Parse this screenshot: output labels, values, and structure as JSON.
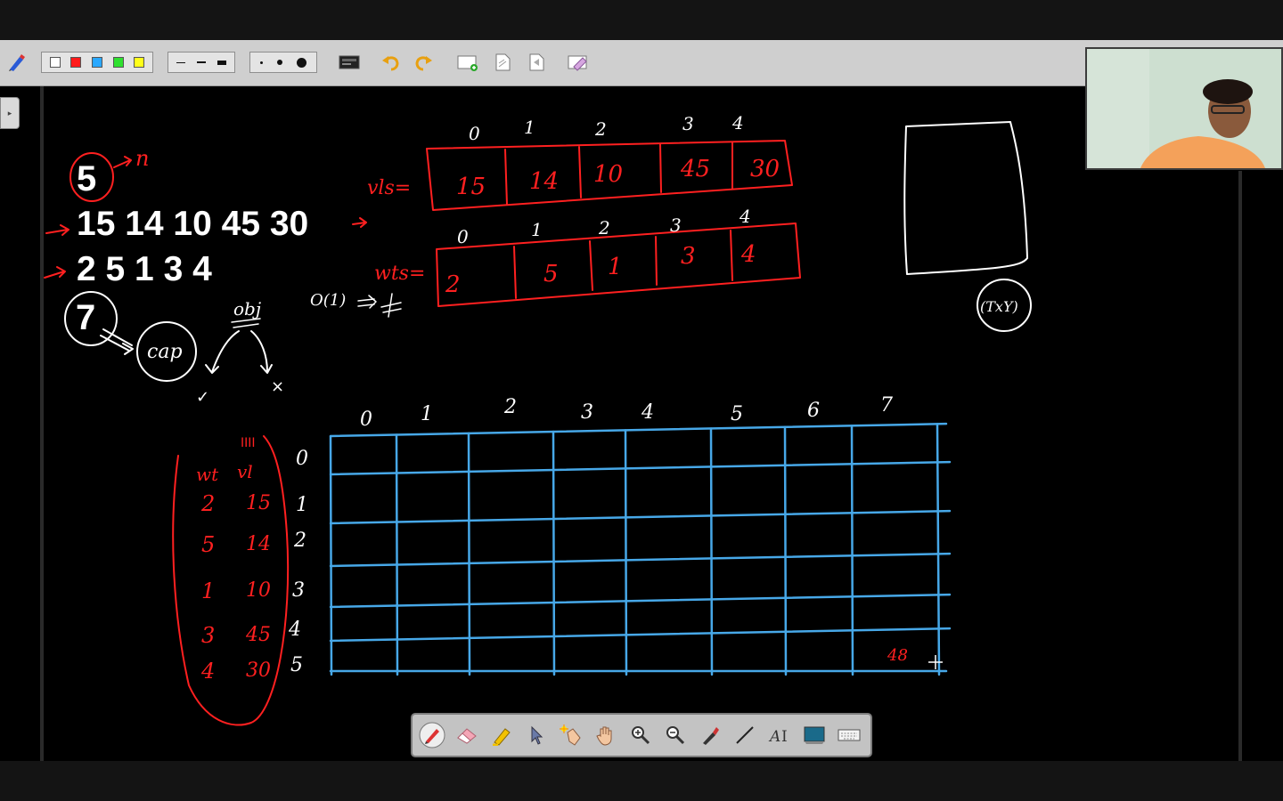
{
  "toolbar": {
    "colors": [
      "#ffffff",
      "#ff1a1a",
      "#2aa8ff",
      "#2fe02f",
      "#ffff1a"
    ],
    "line_widths": [
      "thin",
      "medium",
      "thick"
    ],
    "dot_sizes": [
      "small",
      "medium",
      "large"
    ],
    "icons": [
      "pen-settings-icon",
      "screen-capture-icon",
      "undo-icon",
      "redo-icon",
      "new-page-icon",
      "page-icon",
      "previous-page-icon",
      "clear-icon"
    ]
  },
  "board": {
    "left_notes": {
      "n_value": "5",
      "n_label": "n",
      "values_row": "15 14 10 45 30",
      "weights_row": "2 5 1 3 4",
      "capacity_value": "7",
      "capacity_label": "cap",
      "objective_label": "obj",
      "objective_fn": "O(1)",
      "branch_yes": "✓",
      "branch_no": "×"
    },
    "vls_array": {
      "label": "vls=",
      "indices": [
        "0",
        "1",
        "2",
        "3",
        "4"
      ],
      "values": [
        "15",
        "14",
        "10",
        "45",
        "30"
      ]
    },
    "wts_array": {
      "label": "wts=",
      "indices": [
        "0",
        "1",
        "2",
        "3",
        "4"
      ],
      "values": [
        "2",
        "5",
        "1",
        "3",
        "4"
      ]
    },
    "item_list": {
      "header_wt": "wt",
      "header_vl": "vl",
      "tick_marks": "IIII",
      "rows": [
        {
          "wt": "2",
          "vl": "15"
        },
        {
          "wt": "5",
          "vl": "14"
        },
        {
          "wt": "1",
          "vl": "10"
        },
        {
          "wt": "3",
          "vl": "45"
        },
        {
          "wt": "4",
          "vl": "30"
        }
      ]
    },
    "dp_table": {
      "col_labels": [
        "0",
        "1",
        "2",
        "3",
        "4",
        "5",
        "6",
        "7"
      ],
      "row_labels": [
        "0",
        "1",
        "2",
        "3",
        "4",
        "5"
      ],
      "answer_cell": "48"
    },
    "side_note": "(TxY)"
  },
  "pen_toolbar": {
    "tools": [
      "pen-icon",
      "eraser-icon",
      "highlighter-icon",
      "pointer-icon",
      "laser-pointer-icon",
      "pan-hand-icon",
      "zoom-in-icon",
      "zoom-out-icon",
      "brush-icon",
      "line-icon",
      "text-tool-icon",
      "background-icon",
      "keyboard-icon"
    ]
  }
}
